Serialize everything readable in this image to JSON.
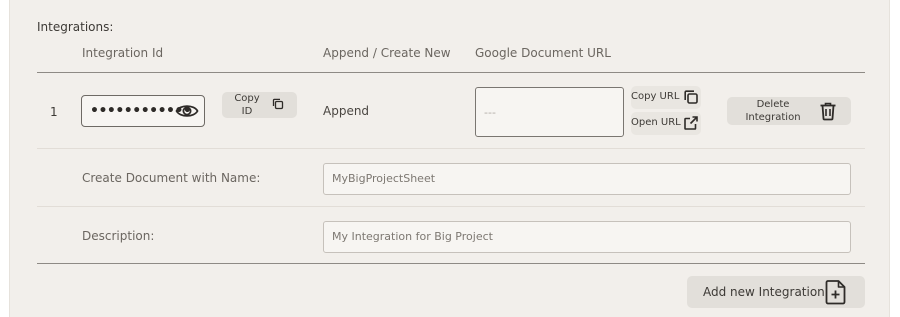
{
  "section": {
    "title": "Integrations:"
  },
  "columns": {
    "integration_id": "Integration Id",
    "append_create": "Append / Create New",
    "google_doc_url": "Google Document URL"
  },
  "row": {
    "number": "1",
    "integration_id_masked": "••••••••••••",
    "copy_id_label_line1": "Copy",
    "copy_id_label_line2": "ID",
    "mode": "Append",
    "url_placeholder": "---",
    "copy_url_label": "Copy URL",
    "open_url_label": "Open URL",
    "delete_label_line1": "Delete",
    "delete_label_line2": "Integration"
  },
  "create_doc": {
    "label": "Create Document with Name:",
    "value": "MyBigProjectSheet"
  },
  "description": {
    "label": "Description:",
    "value": "My Integration for Big Project"
  },
  "actions": {
    "add_label": "Add new Integration"
  },
  "icons": {
    "eye": "eye-icon",
    "copy": "copy-icon",
    "external": "external-link-icon",
    "trash": "trash-icon",
    "file_add": "file-add-icon"
  }
}
